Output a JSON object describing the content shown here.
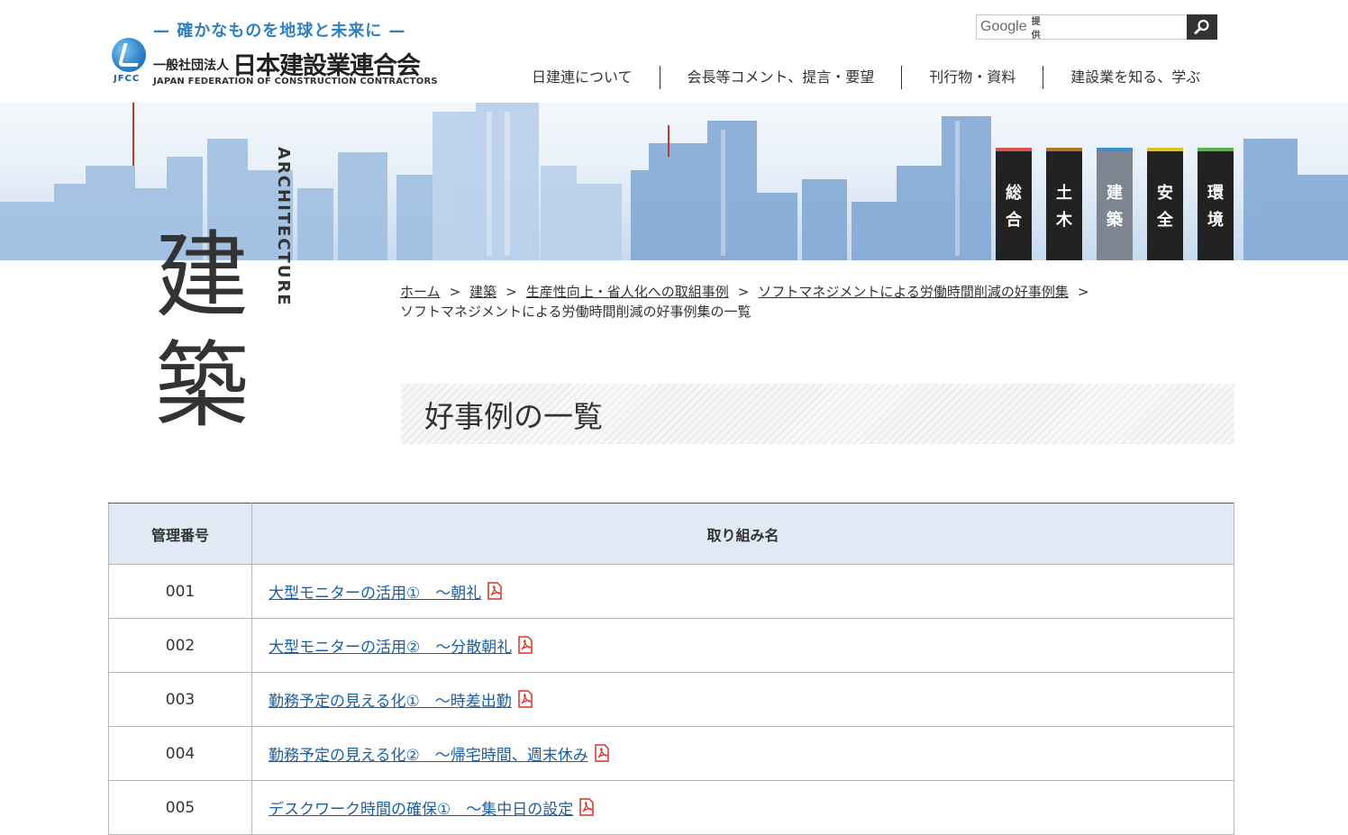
{
  "header": {
    "tagline": "— 確かなものを地球と未来に —",
    "org_type": "一般社団法人",
    "org_name": "日本建設業連合会",
    "org_en": "JAPAN FEDERATION OF CONSTRUCTION CONTRACTORS",
    "mark_text": "JFCC",
    "search": {
      "brand": "Google",
      "provided": "提供",
      "placeholder": ""
    },
    "nav": [
      {
        "label": "日建連について"
      },
      {
        "label": "会長等コメント、提言・要望"
      },
      {
        "label": "刊行物・資料"
      },
      {
        "label": "建設業を知る、学ぶ"
      }
    ]
  },
  "categories": [
    {
      "label": "総合",
      "color": "#d9534f",
      "active": false
    },
    {
      "label": "土木",
      "color": "#b5742a",
      "active": false
    },
    {
      "label": "建築",
      "color": "#3d8fd1",
      "active": true
    },
    {
      "label": "安全",
      "color": "#e0c020",
      "active": false
    },
    {
      "label": "環境",
      "color": "#5ab54a",
      "active": false
    }
  ],
  "side_title": {
    "kanji1": "建",
    "kanji2": "築",
    "en": "ARCHITECTURE"
  },
  "breadcrumb": {
    "items": [
      "ホーム",
      "建築",
      "生産性向上・省人化への取組事例",
      "ソフトマネジメントによる労働時間削減の好事例集"
    ],
    "current": "ソフトマネジメントによる労働時間削減の好事例集の一覧",
    "separator": ">"
  },
  "heading": "好事例の一覧",
  "table": {
    "headers": [
      "管理番号",
      "取り組み名"
    ],
    "rows": [
      {
        "num": "001",
        "name": "大型モニターの活用①　～朝礼"
      },
      {
        "num": "002",
        "name": "大型モニターの活用②　～分散朝礼"
      },
      {
        "num": "003",
        "name": "勤務予定の見える化①　～時差出勤"
      },
      {
        "num": "004",
        "name": "勤務予定の見える化②　～帰宅時間、週末休み"
      },
      {
        "num": "005",
        "name": "デスクワーク時間の確保①　～集中日の設定"
      }
    ]
  }
}
